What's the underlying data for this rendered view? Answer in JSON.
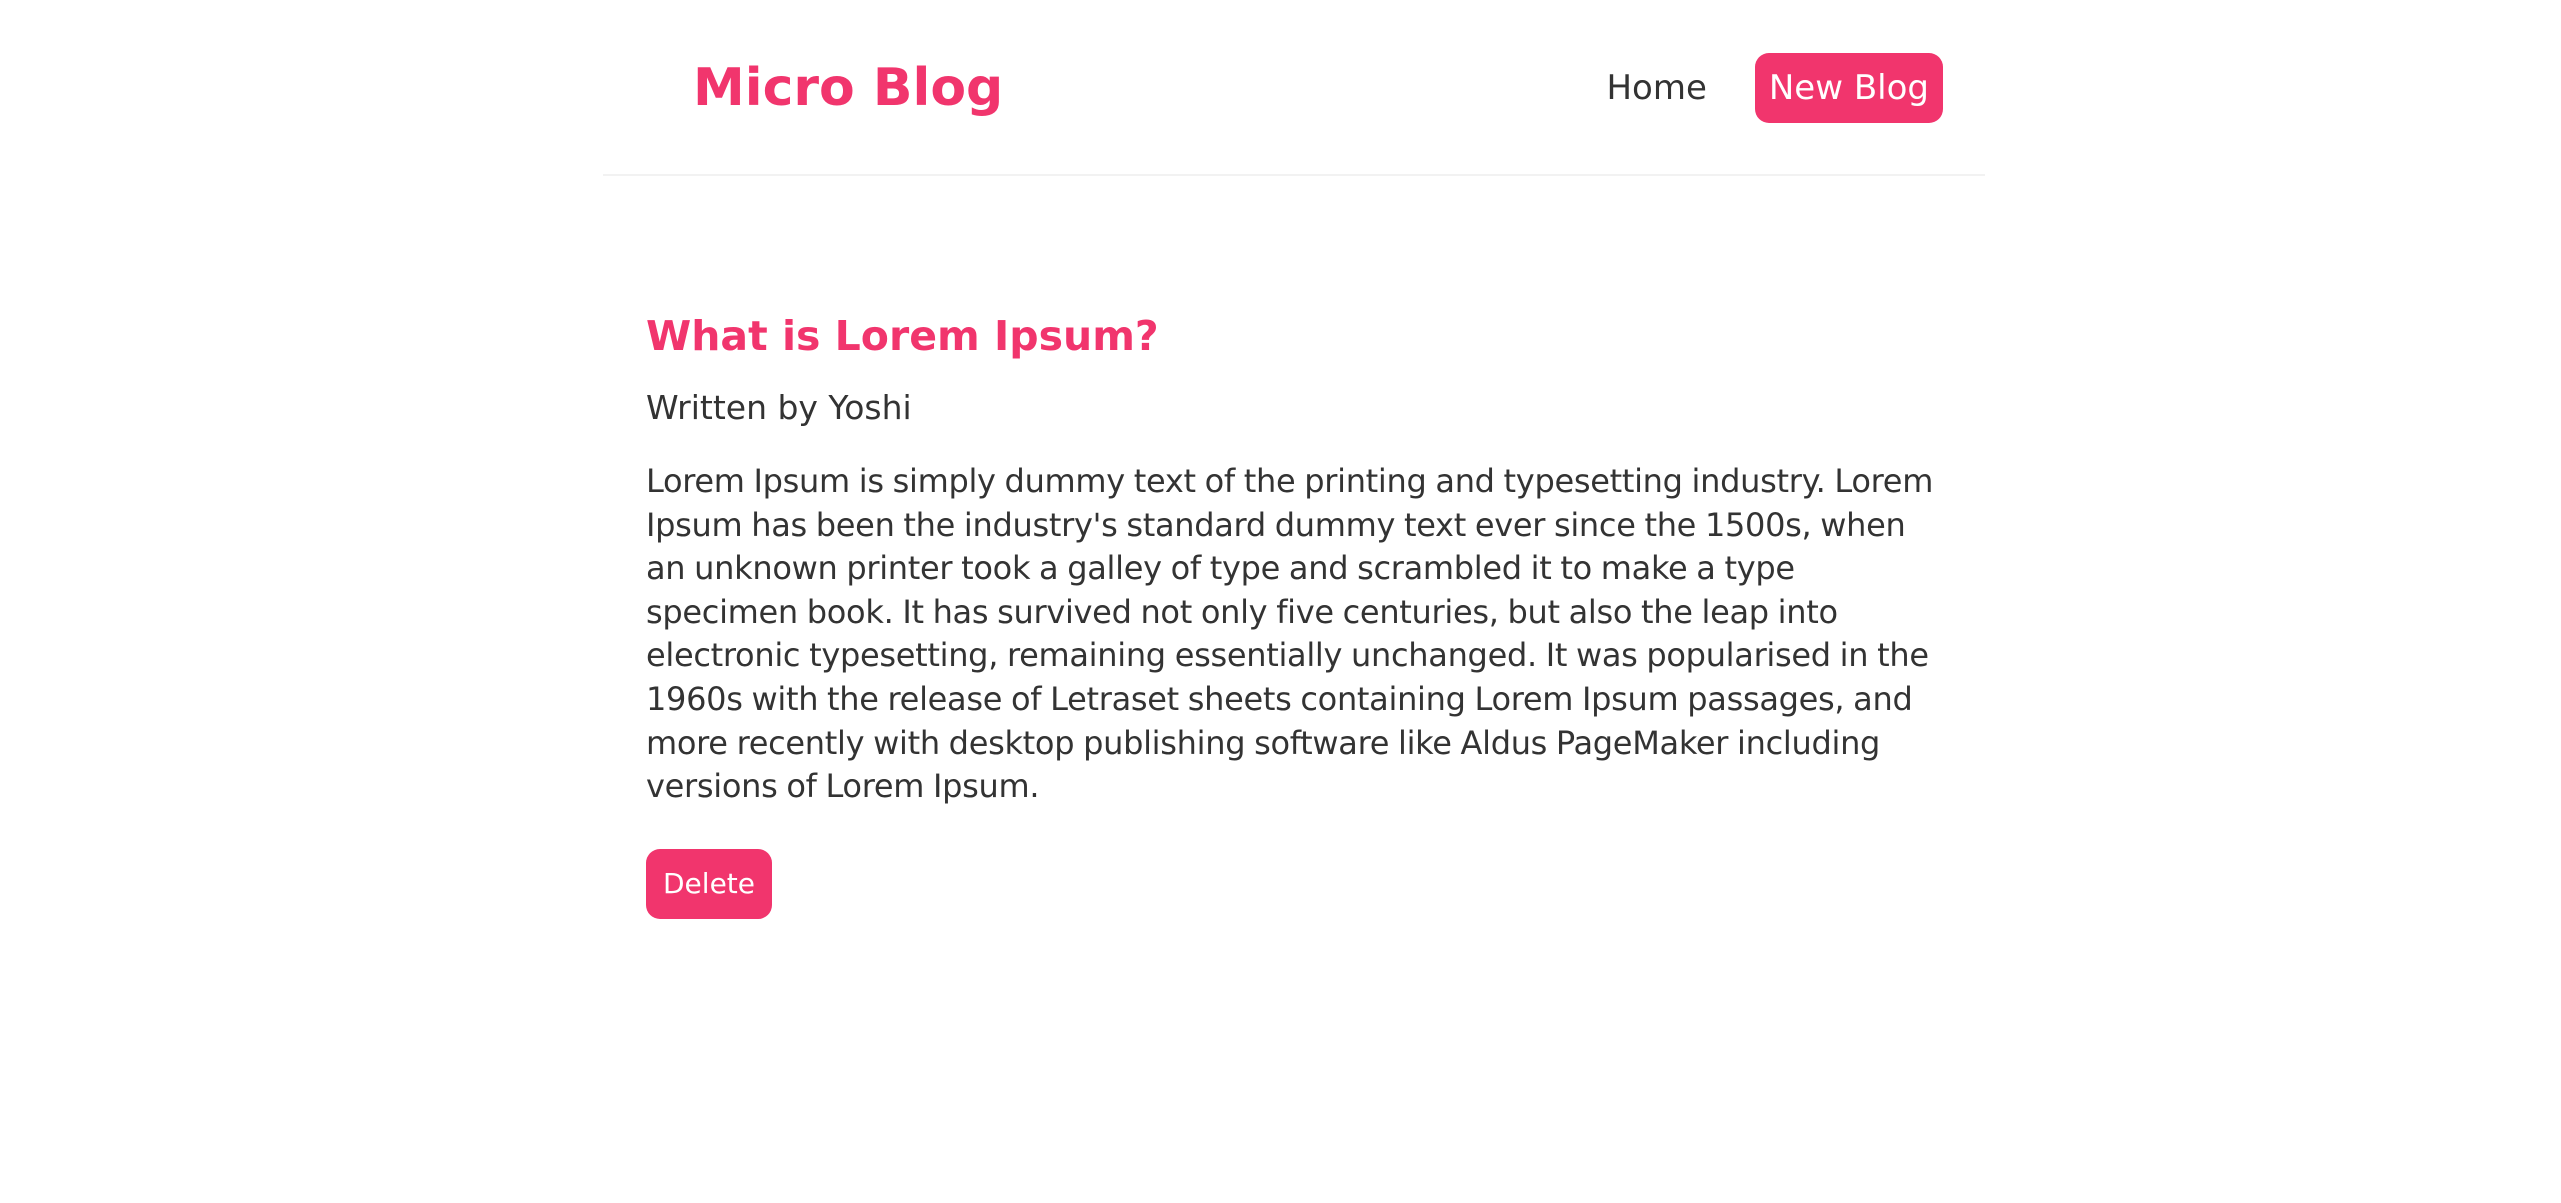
{
  "navbar": {
    "brand": "Micro Blog",
    "links": {
      "home": "Home",
      "new_blog": "New Blog"
    }
  },
  "blog": {
    "title": "What is Lorem Ipsum?",
    "author_line": "Written by Yoshi",
    "body": "Lorem Ipsum is simply dummy text of the printing and typesetting industry. Lorem Ipsum has been the industry's standard dummy text ever since the 1500s, when an unknown printer took a galley of type and scrambled it to make a type specimen book. It has survived not only five centuries, but also the leap into electronic typesetting, remaining essentially unchanged. It was popularised in the 1960s with the release of Letraset sheets containing Lorem Ipsum passages, and more recently with desktop publishing software like Aldus PageMaker including versions of Lorem Ipsum.",
    "delete_label": "Delete"
  },
  "colors": {
    "accent": "#f1356d",
    "text": "#333333",
    "background": "#ffffff",
    "divider": "#f2f2f2"
  }
}
